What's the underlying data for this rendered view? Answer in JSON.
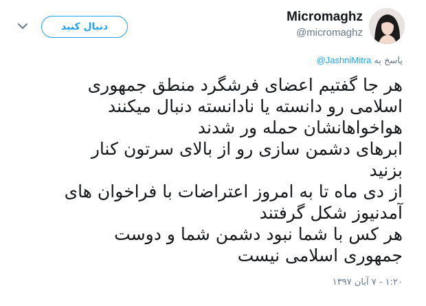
{
  "author": {
    "display_name": "Micromaghz",
    "handle": "@micromaghz",
    "avatar_icon": "profile-photo-icon"
  },
  "follow_button": {
    "label": "دنبال کنید",
    "color": "#1da1f2"
  },
  "menu": {
    "icon": "chevron-down-icon"
  },
  "reply": {
    "prefix": "پاسخ به",
    "mention": "@JashniMitra"
  },
  "tweet": {
    "lines": [
      "هر جا گفتیم اعضای فرشگرد منطق جمهوری",
      "اسلامی رو دانسته یا نادانسته دنبال میکنند",
      "هواخواهانشان حمله ور شدند",
      "ابرهای دشمن سازی رو از بالای سرتون کنار",
      "بزنید",
      "از دی ماه تا به امروز اعتراضات با فراخوان های",
      "آمدنیوز شکل گرفتند",
      "هر کس با شما نبود دشمن شما و دوست",
      "جمهوری اسلامی نیست"
    ]
  },
  "timestamp": "۱:۲۰ - ۷ آبان ۱۳۹۷",
  "colors": {
    "text": "#14171a",
    "secondary": "#657786",
    "link": "#1da1f2"
  }
}
